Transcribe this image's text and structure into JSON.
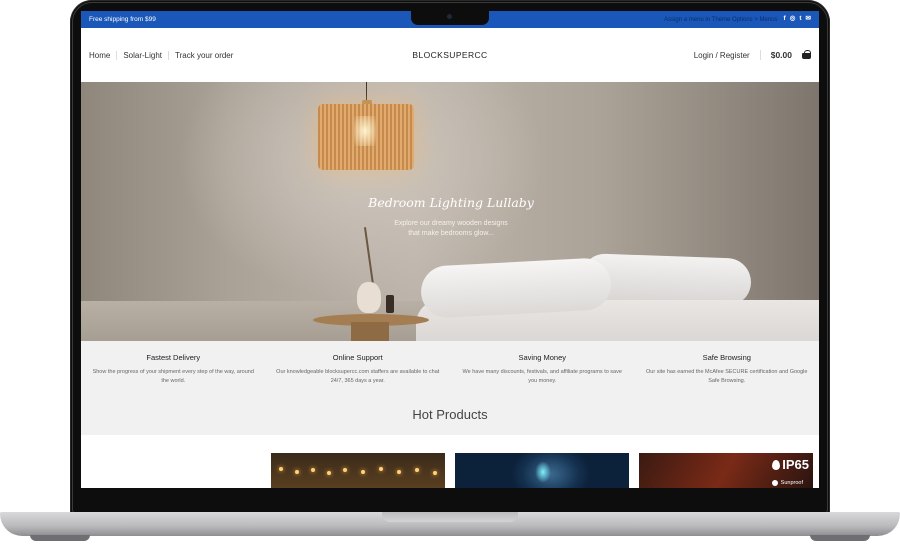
{
  "topbar": {
    "shipping_text": "Free shipping from $99",
    "note_text": "Assign a menu in Theme Options > Menus",
    "social_icons": [
      "facebook-icon",
      "instagram-icon",
      "twitter-icon",
      "email-icon"
    ],
    "social_glyphs": [
      "f",
      "◎",
      "t",
      "✉"
    ],
    "color": "#1a57b8"
  },
  "header": {
    "nav": [
      "Home",
      "Solar-Light",
      "Track your order"
    ],
    "brand": "BLOCKSUPERCC",
    "login_label": "Login / Register",
    "cart_total": "$0.00"
  },
  "hero": {
    "title": "Bedroom Lighting Lullaby",
    "subtitle_line1": "Explore our dreamy wooden designs",
    "subtitle_line2": "that make bedrooms glow..."
  },
  "features": [
    {
      "title": "Fastest Delivery",
      "desc": "Show the progress of your shipment every step of the way, around the world."
    },
    {
      "title": "Online Support",
      "desc": "Our knowledgeable blocksupercc.com staffers are available to chat 24/7, 365 days a year."
    },
    {
      "title": "Saving Money",
      "desc": "We have many discounts, festivals, and affiliate programs to save you money."
    },
    {
      "title": "Safe Browsing",
      "desc": "Our site has earned the McAfee SECURE certification and Google Safe Browsing."
    }
  ],
  "hot_products": {
    "title": "Hot Products",
    "badge": "IP65",
    "sunproof_label": "Sunproof"
  }
}
